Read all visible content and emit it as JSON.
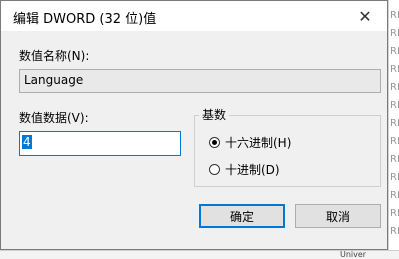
{
  "dialog": {
    "title": "编辑 DWORD (32 位)值",
    "close_glyph": "✕",
    "value_name_label": "数值名称(N):",
    "value_name": "Language",
    "value_data_label": "数值数据(V):",
    "value_data": "4",
    "base_label": "基数",
    "radios": [
      {
        "label": "十六进制(H)",
        "checked": true
      },
      {
        "label": "十进制(D)",
        "checked": false
      }
    ],
    "ok_label": "确定",
    "cancel_label": "取消"
  },
  "background": {
    "reg_items": [
      "RE",
      "RE",
      "RE",
      "RE",
      "RE",
      "RE",
      "RE",
      "RE",
      "RE",
      "RE",
      "RE",
      "RE",
      "RE"
    ],
    "bottom_cells": [
      "Univer"
    ]
  }
}
